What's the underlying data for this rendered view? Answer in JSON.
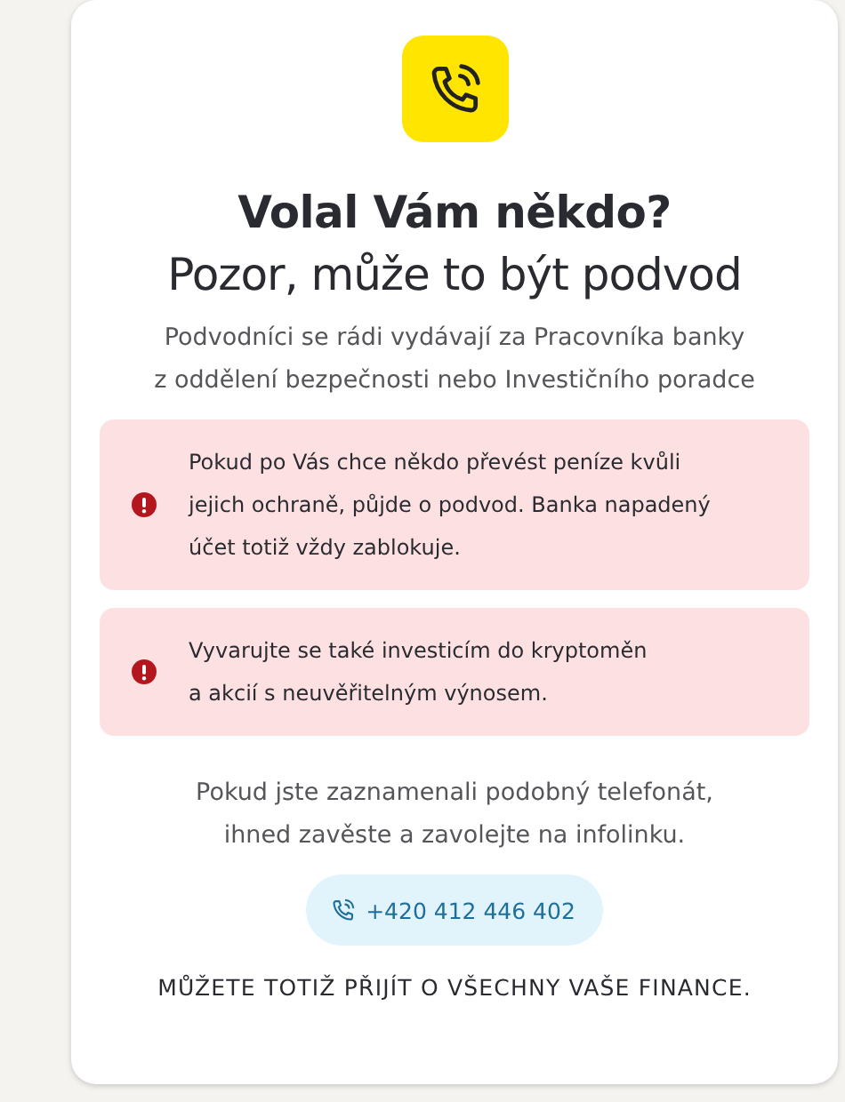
{
  "card": {
    "title": "Volal Vám někdo?",
    "subtitle": "Pozor, může to být podvod",
    "description": "Podvodníci se rádi vydávají za Pracovníka banky\nz oddělení bezpečnosti nebo Investičního poradce",
    "alerts": [
      {
        "text": "Pokud po Vás chce někdo převést peníze kvůli\njejich ochraně, půjde o podvod. Banka napadený\núčet totiž vždy zablokuje."
      },
      {
        "text": "Vyvarujte se také investicím do kryptoměn\na akcií s neuvěřitelným výnosem."
      }
    ],
    "advice": "Pokud jste zaznamenali podobný telefonát,\nihned zavěste a zavolejte na infolinku.",
    "phone_button": "+420 412 446 402",
    "warning": "MŮŽETE TOTIŽ PŘIJÍT O VŠECHNY VAŠE FINANCE."
  }
}
